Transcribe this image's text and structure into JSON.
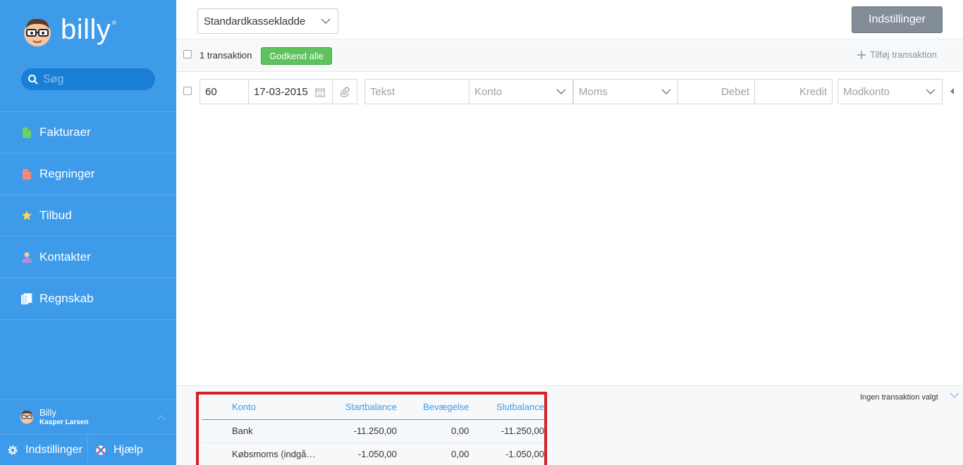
{
  "sidebar": {
    "logo_text": "billy",
    "logo_reg": "®",
    "search_placeholder": "Søg",
    "nav": [
      {
        "label": "Fakturaer",
        "icon": "invoice-icon",
        "color": "#6ad06a"
      },
      {
        "label": "Regninger",
        "icon": "bill-icon",
        "color": "#f08a7a"
      },
      {
        "label": "Tilbud",
        "icon": "star-icon",
        "color": "#f5d95a"
      },
      {
        "label": "Kontakter",
        "icon": "person-icon",
        "color": "#b48ce0"
      },
      {
        "label": "Regnskab",
        "icon": "ledger-icon",
        "color": "#ffffff"
      }
    ],
    "user": {
      "name": "Billy",
      "subtitle": "Kasper Larsen"
    },
    "bottom": {
      "settings": "Indstillinger",
      "help": "Hjælp"
    }
  },
  "header": {
    "journal_select": "Standardkassekladde",
    "settings_button": "Indstillinger"
  },
  "toolbar": {
    "tx_count": "1 transaktion",
    "approve_all": "Godkend alle",
    "add_transaction": "Tilføj transaktion"
  },
  "entry_row": {
    "number": "60",
    "date": "17-03-2015",
    "text_placeholder": "Tekst",
    "account_placeholder": "Konto",
    "vat_placeholder": "Moms",
    "debit_placeholder": "Debet",
    "credit_placeholder": "Kredit",
    "counter_account_placeholder": "Modkonto"
  },
  "balance_panel": {
    "no_transaction": "Ingen transaktion valgt",
    "headers": {
      "account": "Konto",
      "start": "Startbalance",
      "movement": "Bevægelse",
      "end": "Slutbalance"
    },
    "rows": [
      {
        "account": "Bank",
        "start": "-11.250,00",
        "movement": "0,00",
        "end": "-11.250,00"
      },
      {
        "account": "Købsmoms (indgå…",
        "start": "-1.050,00",
        "movement": "0,00",
        "end": "-1.050,00"
      }
    ]
  },
  "colors": {
    "sidebar": "#3d9be9",
    "approve": "#5ec25d",
    "highlight": "#d81f2a",
    "settings_button": "#828d98"
  }
}
